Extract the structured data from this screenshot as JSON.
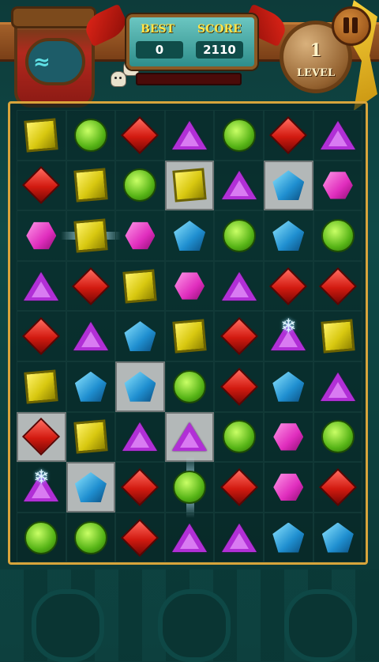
{
  "hud": {
    "best_label": "BEST",
    "best_value": "0",
    "score_label": "SCORE",
    "score_value": "2110",
    "level_value": "1",
    "level_label": "LEVEL",
    "progress_fraction": 0.0
  },
  "board": {
    "columns": 7,
    "rows": 9,
    "cells": [
      [
        "yellow-square",
        "green-circle",
        "red-diamond",
        "purple-triangle",
        "green-circle",
        "red-diamond",
        "purple-triangle"
      ],
      [
        "red-diamond",
        "yellow-square",
        "green-circle",
        "yellow-square|tile",
        "purple-triangle",
        "blue-pentagon|tile",
        "pink-hexagon"
      ],
      [
        "pink-hexagon",
        "yellow-square|flash-h",
        "pink-hexagon",
        "blue-pentagon",
        "green-circle",
        "blue-pentagon",
        "green-circle"
      ],
      [
        "purple-triangle",
        "red-diamond",
        "yellow-square",
        "pink-hexagon",
        "purple-triangle",
        "red-diamond",
        "red-diamond"
      ],
      [
        "red-diamond",
        "purple-triangle",
        "blue-pentagon",
        "yellow-square",
        "red-diamond",
        "purple-triangle|snow",
        "yellow-square"
      ],
      [
        "yellow-square",
        "blue-pentagon",
        "blue-pentagon|tile",
        "green-circle",
        "red-diamond",
        "blue-pentagon",
        "purple-triangle"
      ],
      [
        "red-diamond|tile",
        "yellow-square",
        "purple-triangle",
        "purple-triangle|tile",
        "green-circle",
        "pink-hexagon",
        "green-circle"
      ],
      [
        "purple-triangle|snow",
        "blue-pentagon|tile",
        "red-diamond",
        "green-circle|flash-v",
        "red-diamond",
        "pink-hexagon",
        "red-diamond"
      ],
      [
        "green-circle",
        "green-circle",
        "red-diamond",
        "purple-triangle",
        "purple-triangle",
        "blue-pentagon",
        "blue-pentagon"
      ]
    ]
  },
  "icons": {
    "pause": "pause-icon",
    "snowflake": "❄"
  },
  "colors": {
    "background": "#0f4a47",
    "board_border": "#d8a43b",
    "score_text": "#ffe54a"
  }
}
